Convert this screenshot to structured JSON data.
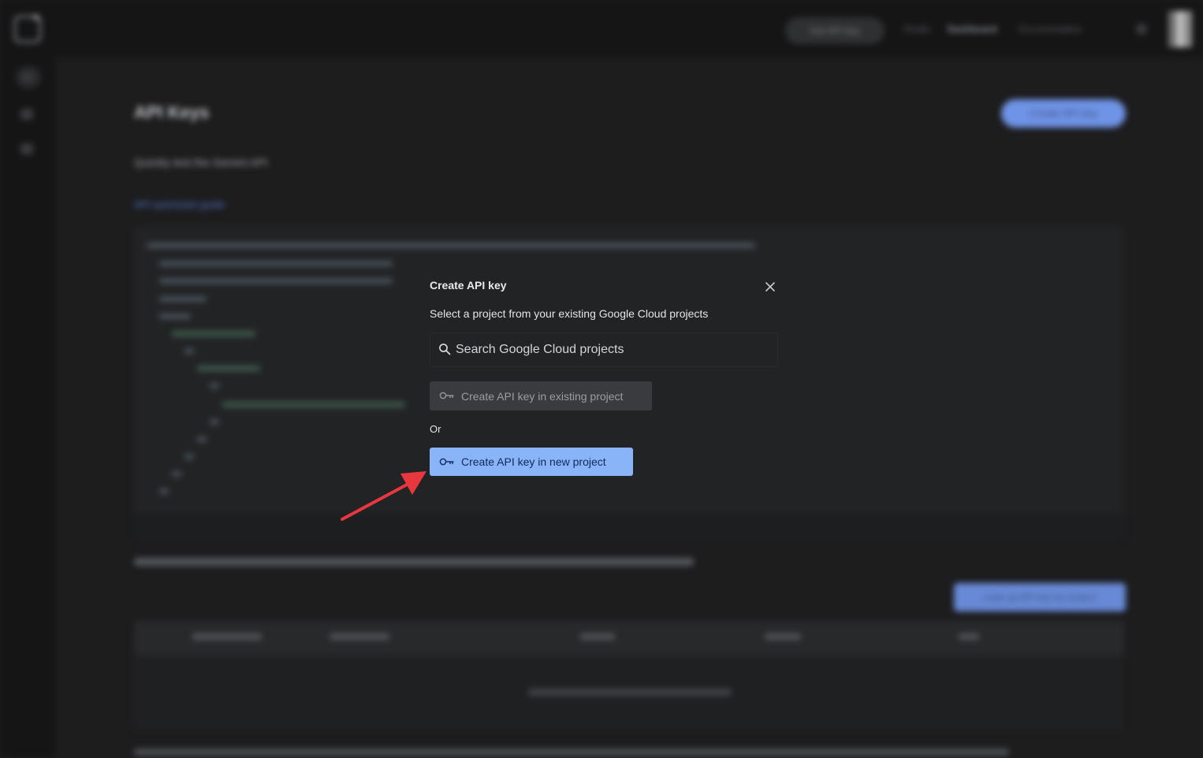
{
  "background": {
    "rail_badge": "G+",
    "top_button": "Get API key",
    "top_links": [
      "Studio",
      "Dashboard",
      "Documentation"
    ],
    "page_title": "API Keys",
    "page_subtitle": "Quickly test the Gemini API",
    "page_link": "API quickstart guide",
    "create_key_button": "Create API key",
    "lookup_button": "Look up API key for project"
  },
  "dialog": {
    "title": "Create API key",
    "description": "Select a project from your existing Google Cloud projects",
    "search_placeholder": "Search Google Cloud projects",
    "existing_project_button": "Create API key in existing project",
    "or_text": "Or",
    "new_project_button": "Create API key in new project"
  },
  "colors": {
    "dialog_bg": "#222325",
    "primary_button": "#8ab4f8",
    "disabled_button": "#3a3b3e",
    "annotation_arrow": "#e8373f"
  },
  "icons": {
    "close": "close-icon",
    "search": "search-icon",
    "key": "key-icon"
  }
}
